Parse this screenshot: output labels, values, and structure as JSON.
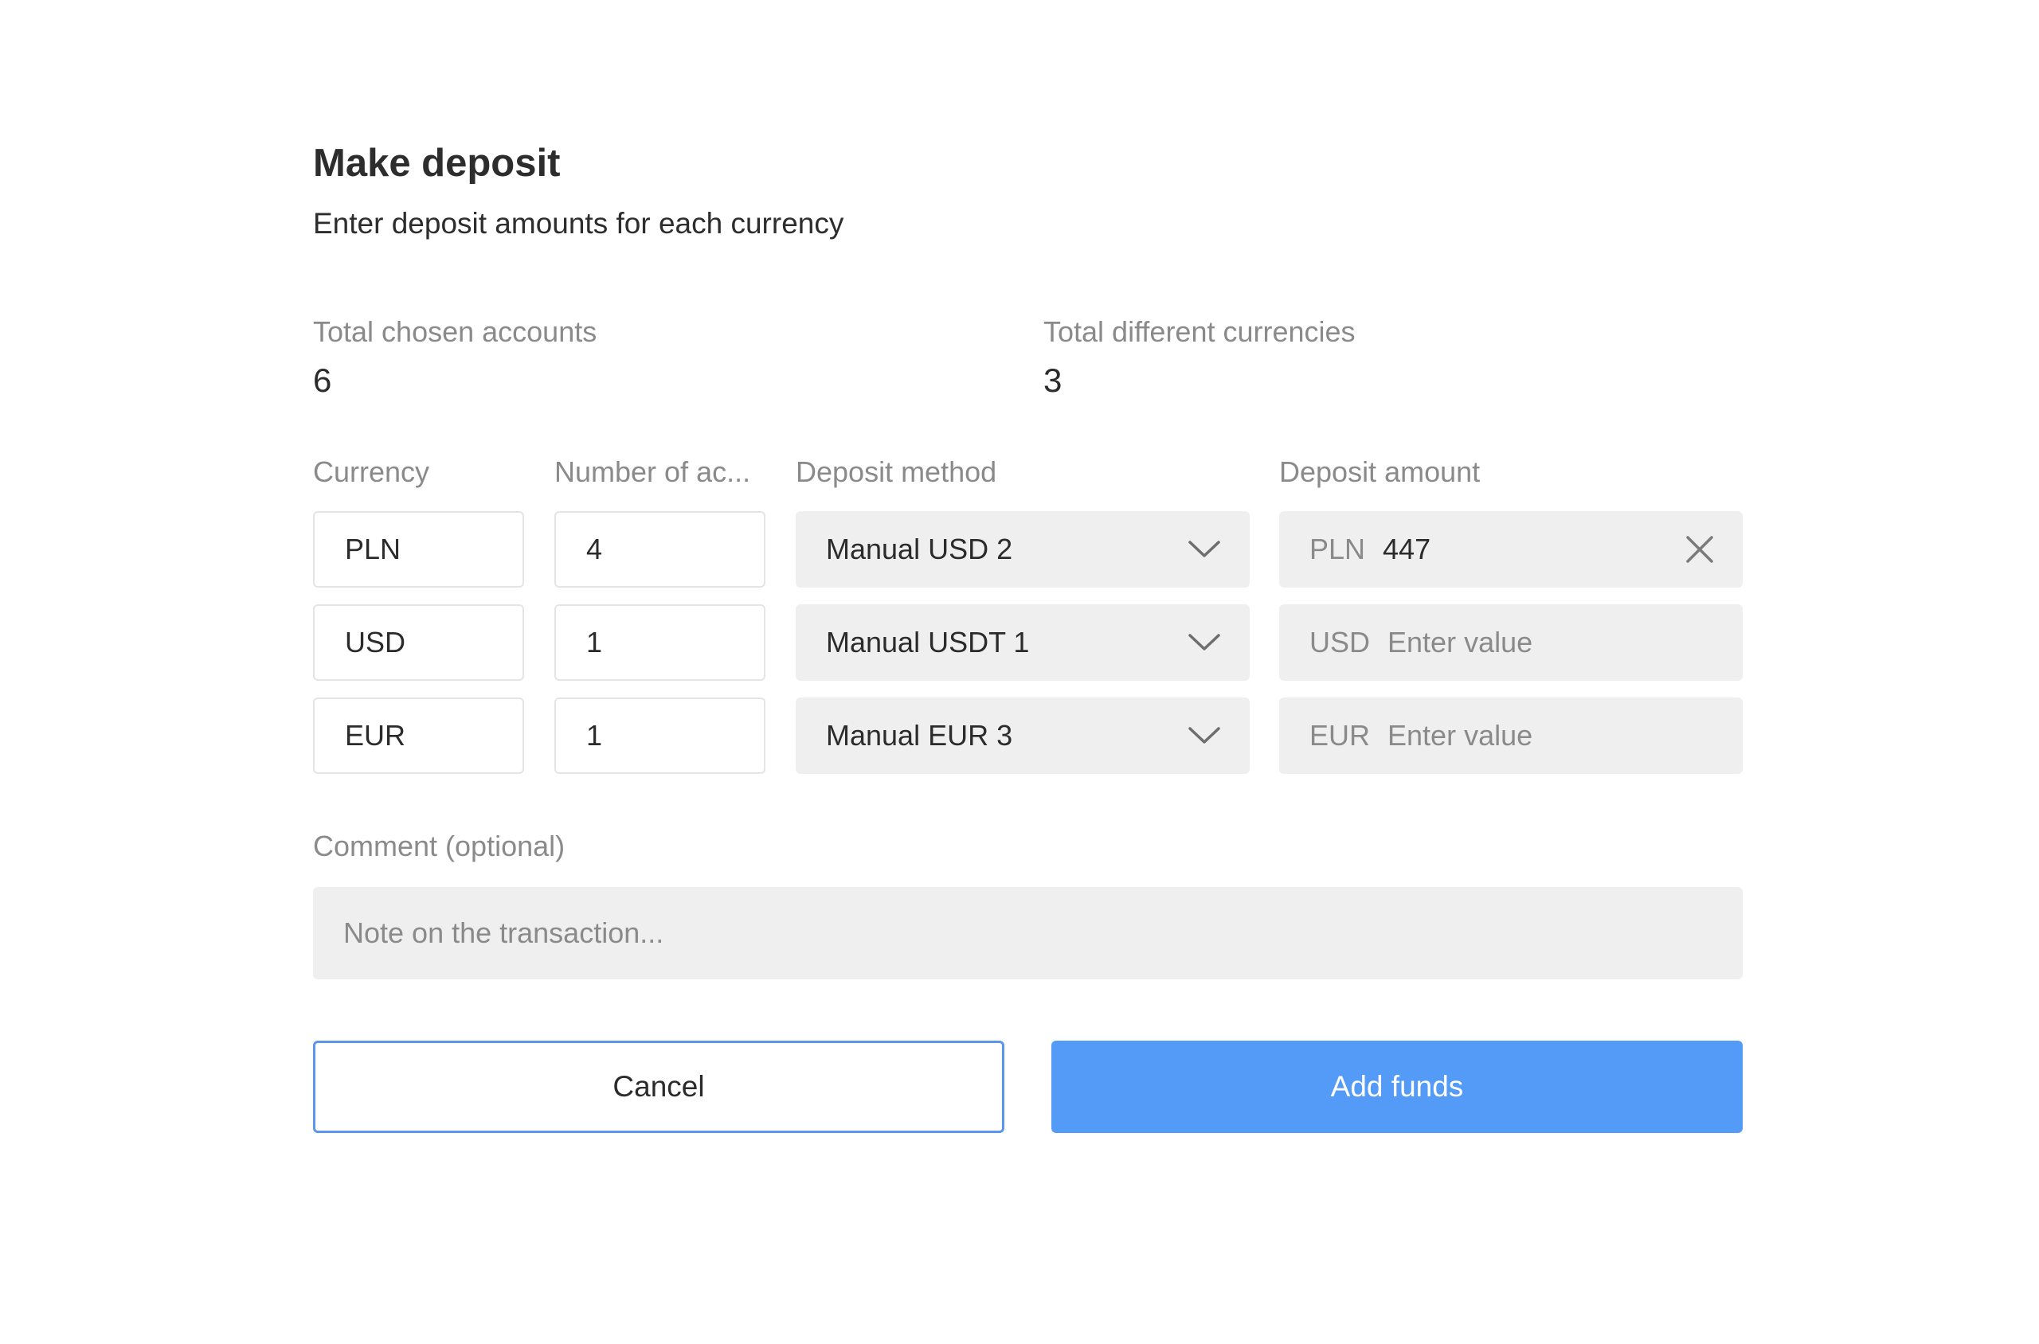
{
  "dialog": {
    "title": "Make deposit",
    "subtitle": "Enter deposit amounts for each currency"
  },
  "stats": {
    "accounts_label": "Total chosen accounts",
    "accounts_value": "6",
    "currencies_label": "Total different currencies",
    "currencies_value": "3"
  },
  "columns": {
    "currency": "Currency",
    "num_accounts": "Number of ac...",
    "method": "Deposit method",
    "amount": "Deposit amount"
  },
  "rows": [
    {
      "currency": "PLN",
      "count": "4",
      "method": "Manual USD 2",
      "amount_prefix": "PLN",
      "amount_value": "447",
      "amount_placeholder": ""
    },
    {
      "currency": "USD",
      "count": "1",
      "method": "Manual USDT 1",
      "amount_prefix": "USD",
      "amount_value": "",
      "amount_placeholder": "Enter value"
    },
    {
      "currency": "EUR",
      "count": "1",
      "method": "Manual EUR 3",
      "amount_prefix": "EUR",
      "amount_value": "",
      "amount_placeholder": "Enter value"
    }
  ],
  "comment": {
    "label": "Comment (optional)",
    "placeholder": "Note on the transaction..."
  },
  "buttons": {
    "cancel": "Cancel",
    "add_funds": "Add funds"
  },
  "icons": {
    "dropdown": "chevron-down-icon",
    "clear": "close-icon"
  },
  "colors": {
    "primary": "#549bf8",
    "primary_border": "#5b96eb",
    "field_background": "#efefef",
    "muted_text": "#8a8a8a"
  }
}
